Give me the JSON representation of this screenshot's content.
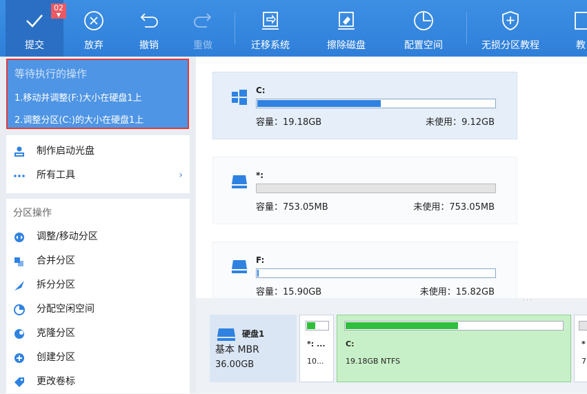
{
  "toolbar": {
    "submit": {
      "label": "提交",
      "badge": "02"
    },
    "discard": {
      "label": "放弃"
    },
    "undo": {
      "label": "撤销"
    },
    "redo": {
      "label": "重做"
    },
    "migrate": {
      "label": "迁移系统"
    },
    "wipe": {
      "label": "擦除磁盘"
    },
    "allocate": {
      "label": "配置空间"
    },
    "tutorial": {
      "label": "无损分区教程"
    },
    "more": {
      "label": "教"
    }
  },
  "pending": {
    "title": "等待执行的操作",
    "ops": [
      "1.移动并调整(F:)大小在硬盘1上",
      "2.调整分区(C:)的大小在硬盘1上"
    ]
  },
  "sidebar": {
    "tools": [
      {
        "label": "制作启动光盘",
        "icon": "boot-disc-icon"
      },
      {
        "label": "所有工具",
        "icon": "more-dots-icon"
      }
    ],
    "section_title": "分区操作",
    "operations": [
      {
        "label": "调整/移动分区",
        "icon": "resize-icon"
      },
      {
        "label": "合并分区",
        "icon": "merge-icon"
      },
      {
        "label": "拆分分区",
        "icon": "split-icon"
      },
      {
        "label": "分配空闲空间",
        "icon": "allocate-icon"
      },
      {
        "label": "克隆分区",
        "icon": "clone-icon"
      },
      {
        "label": "创建分区",
        "icon": "create-icon"
      },
      {
        "label": "更改卷标",
        "icon": "label-icon"
      }
    ]
  },
  "partitions": [
    {
      "name": "C:",
      "capacity_label": "容量：",
      "capacity": "19.18GB",
      "free_label": "未使用：",
      "free": "9.12GB",
      "used_fraction": 0.52
    },
    {
      "name": "*:",
      "capacity_label": "容量：",
      "capacity": "753.05MB",
      "free_label": "未使用：",
      "free": "753.05MB",
      "used_fraction": 0
    },
    {
      "name": "F:",
      "capacity_label": "容量：",
      "capacity": "15.90GB",
      "free_label": "未使用：",
      "free": "15.82GB",
      "used_fraction": 0.005
    }
  ],
  "disk": {
    "name": "硬盘1",
    "type": "基本 MBR",
    "size": "36.00GB",
    "segments": [
      {
        "name": "*: ...",
        "desc": "10...",
        "used_fraction": 0.4
      },
      {
        "name": "C:",
        "desc": "19.18GB NTFS",
        "used_fraction": 0.52
      }
    ],
    "partial_segment": {
      "name": "*",
      "desc": "7"
    }
  },
  "colors": {
    "toolbar": "#2f7fd9",
    "accent": "#2f82e0",
    "highlight_border": "#e23a3a",
    "used_green": "#2fbf3c"
  }
}
